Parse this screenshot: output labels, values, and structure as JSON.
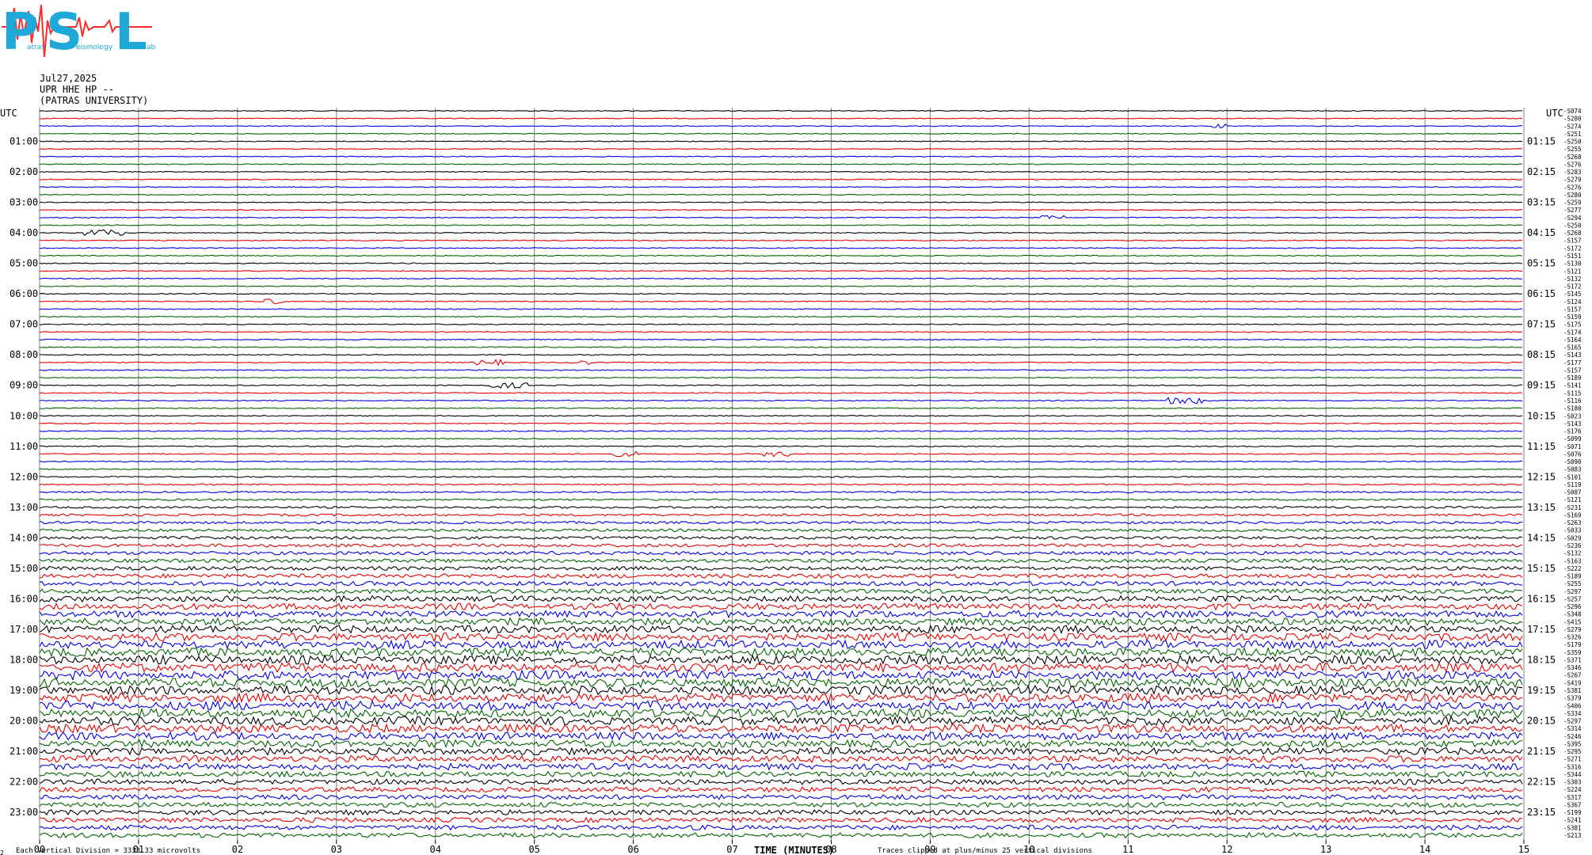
{
  "logo": {
    "letters": [
      "P",
      "S",
      "L"
    ],
    "small_words": [
      "atras",
      "eismology",
      "ab"
    ],
    "colors": {
      "letters": "#1fa9d8",
      "trace": "#ff2a2a"
    }
  },
  "header": {
    "date": "Jul27,2025",
    "station": "UPR HHE HP --",
    "institution": "(PATRAS UNIVERSITY)"
  },
  "footer": {
    "left_tick": "2",
    "scale_note": "Each Vertical Division = 3333.33 microvolts",
    "clip_note": "Traces clipped at plus/minus 25 vertical divisions"
  },
  "colors": {
    "trace_cycle": [
      "#000000",
      "#e60000",
      "#0000e6",
      "#006400"
    ],
    "grid": "#7f7f7f"
  },
  "chart_data": {
    "type": "helicorder",
    "xlabel": "TIME (MINUTES)",
    "x_ticks": [
      "00",
      "01",
      "02",
      "03",
      "04",
      "05",
      "06",
      "07",
      "08",
      "09",
      "10",
      "11",
      "12",
      "13",
      "14",
      "15"
    ],
    "xlim": [
      0,
      15
    ],
    "left_axis_title": "UTC",
    "right_axis_title": "UTC",
    "left_hour_labels": [
      "01:00",
      "02:00",
      "03:00",
      "04:00",
      "05:00",
      "06:00",
      "07:00",
      "08:00",
      "09:00",
      "10:00",
      "11:00",
      "12:00",
      "13:00",
      "14:00",
      "15:00",
      "16:00",
      "17:00",
      "18:00",
      "19:00",
      "20:00",
      "21:00",
      "22:00",
      "23:00"
    ],
    "right_hour_labels": [
      "01:15",
      "02:15",
      "03:15",
      "04:15",
      "05:15",
      "06:15",
      "07:15",
      "08:15",
      "09:15",
      "10:15",
      "11:15",
      "12:15",
      "13:15",
      "14:15",
      "15:15",
      "16:15",
      "17:15",
      "18:15",
      "19:15",
      "20:15",
      "21:15",
      "22:15",
      "23:15"
    ],
    "line_minutes": 15,
    "line_count": 96,
    "trace_offsets": [
      "-S074",
      "-S280",
      "-S274",
      "-S251",
      "-S250",
      "-S255",
      "-S268",
      "-S276",
      "-S283",
      "-S279",
      "-S276",
      "-S280",
      "-S259",
      "-S277",
      "-S294",
      "-S250",
      "-S268",
      "-S157",
      "-S172",
      "-S151",
      "-S130",
      "-S121",
      "-S132",
      "-S172",
      "-S145",
      "-S124",
      "-S157",
      "-S159",
      "-S175",
      "-S174",
      "-S164",
      "-S165",
      "-S143",
      "-S177",
      "-S157",
      "-S189",
      "-S141",
      "-S115",
      "-S116",
      "-S180",
      "-S023",
      "-S143",
      "-S176",
      "-S099",
      "-S071",
      "-S076",
      "-S090",
      "-S083",
      "-S101",
      "-S119",
      "-S087",
      "-S121",
      "-S231",
      "-S169",
      "-S263",
      "-S033",
      "-S029",
      "-S236",
      "-S132",
      "-S163",
      "-S222",
      "-S189",
      "-S255",
      "-S297",
      "-S257",
      "-S296",
      "-S348",
      "-S415",
      "-S279",
      "-S326",
      "-S179",
      "-S359",
      "-S371",
      "-S346",
      "-S267",
      "-S419",
      "-S381",
      "-S379",
      "-S406",
      "-S334",
      "-S297",
      "-S314",
      "-S246",
      "-S395",
      "-S295",
      "-S271",
      "-S316",
      "-S344",
      "-S303",
      "-S224",
      "-S317",
      "-S367",
      "-S199",
      "-S241",
      "-S381",
      "-S213"
    ],
    "activity_profile": {
      "hours_quiet": [
        0,
        12
      ],
      "hours_rising": [
        12,
        16
      ],
      "hours_active": [
        16,
        24
      ]
    },
    "events": [
      {
        "line": 16,
        "minute_start": 0.45,
        "minute_end": 0.85,
        "strength": 2.2
      },
      {
        "line": 25,
        "minute_start": 2.25,
        "minute_end": 2.45,
        "strength": 2.0
      },
      {
        "line": 33,
        "minute_start": 4.4,
        "minute_end": 4.7,
        "strength": 1.8
      },
      {
        "line": 33,
        "minute_start": 5.35,
        "minute_end": 5.55,
        "strength": 1.5
      },
      {
        "line": 36,
        "minute_start": 4.55,
        "minute_end": 4.95,
        "strength": 1.8
      },
      {
        "line": 38,
        "minute_start": 11.4,
        "minute_end": 11.75,
        "strength": 2.2
      },
      {
        "line": 45,
        "minute_start": 5.8,
        "minute_end": 6.05,
        "strength": 1.6
      },
      {
        "line": 45,
        "minute_start": 7.3,
        "minute_end": 7.6,
        "strength": 1.6
      },
      {
        "line": 14,
        "minute_start": 10.1,
        "minute_end": 10.35,
        "strength": 1.4
      },
      {
        "line": 2,
        "minute_start": 11.8,
        "minute_end": 12.0,
        "strength": 1.2
      }
    ]
  }
}
